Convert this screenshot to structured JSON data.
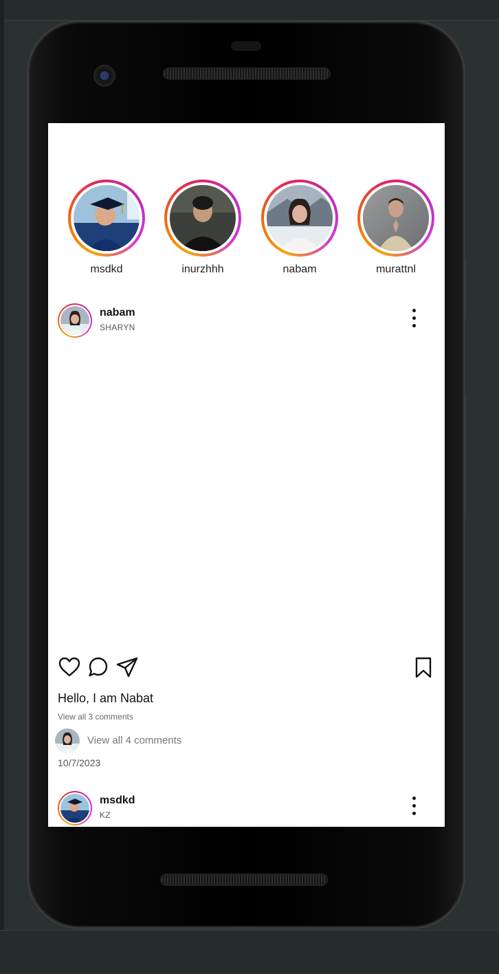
{
  "stories": [
    {
      "username": "msdkd"
    },
    {
      "username": "inurzhhh"
    },
    {
      "username": "nabam"
    },
    {
      "username": "murattnl"
    }
  ],
  "posts": [
    {
      "username": "nabam",
      "location": "SHARYN",
      "caption": "Hello, I am Nabat",
      "view_comments": "View all 3 comments",
      "comment_prompt": "View all 4 comments",
      "date": "10/7/2023"
    },
    {
      "username": "msdkd",
      "location": "KZ"
    }
  ],
  "icons": {
    "like": "heart-icon",
    "comment": "comment-icon",
    "share": "send-icon",
    "save": "bookmark-icon",
    "more": "more-vertical-icon"
  },
  "colors": {
    "story_ring_start": "#f9a200",
    "story_ring_mid": "#e3245c",
    "story_ring_end": "#c12aba",
    "background": "#ffffff",
    "device": "#000000"
  }
}
